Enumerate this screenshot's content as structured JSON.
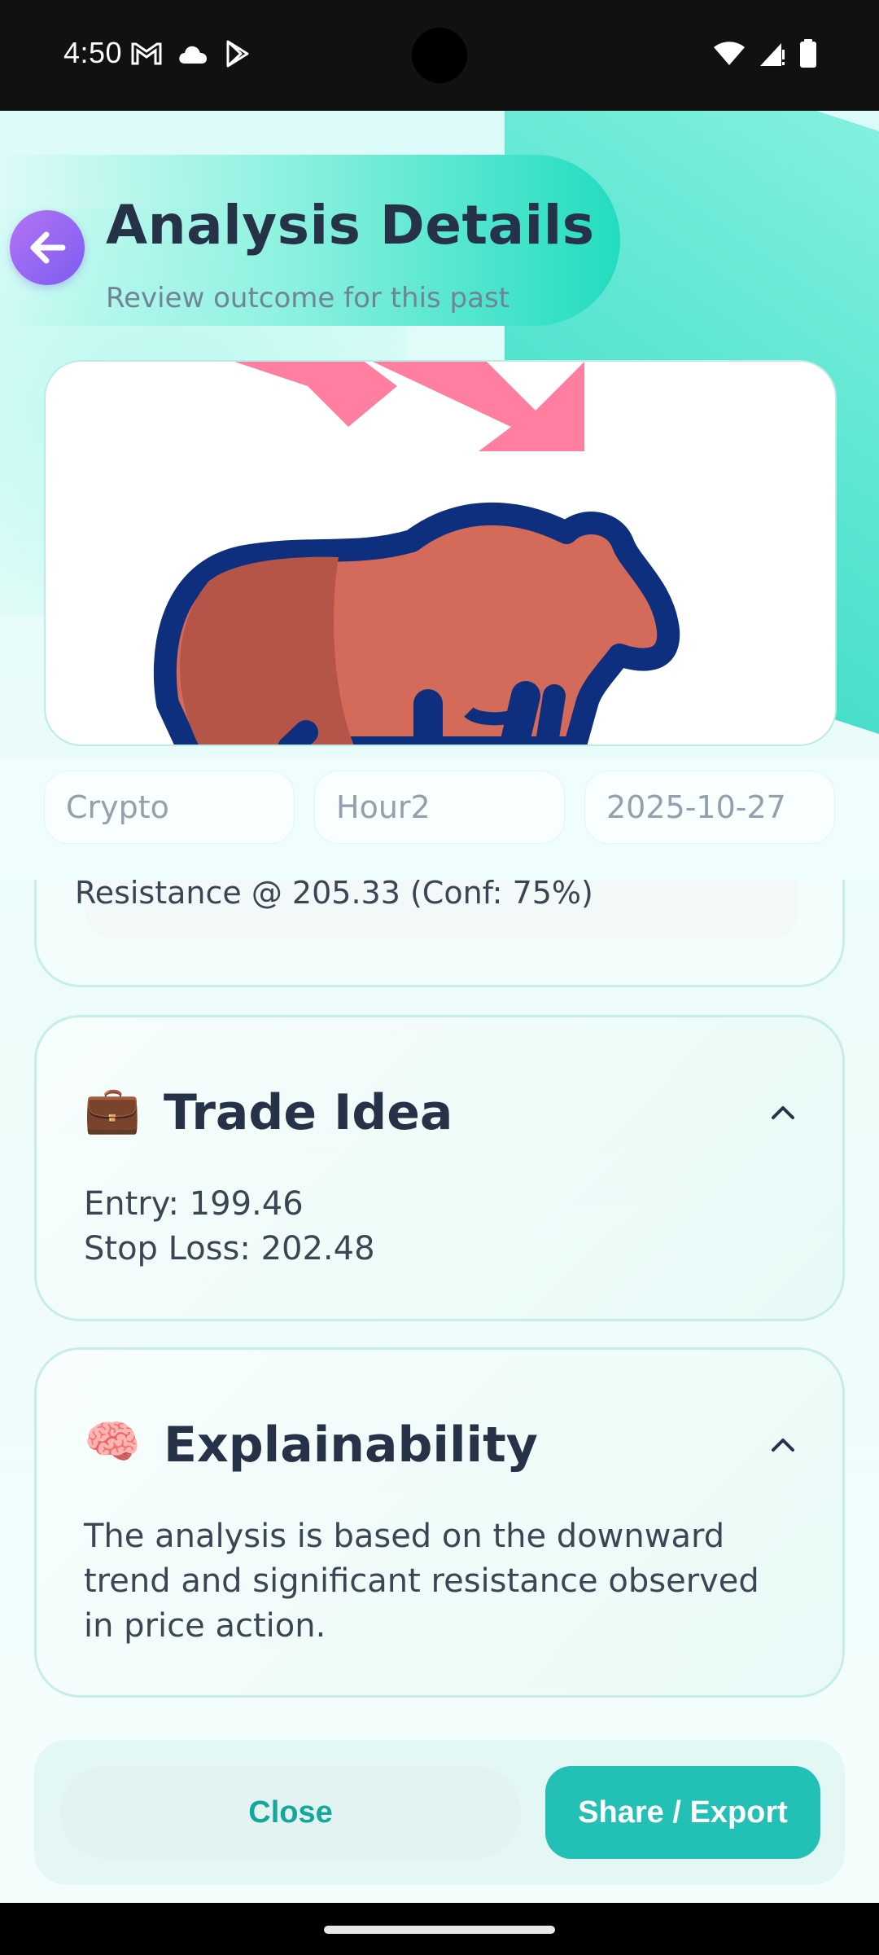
{
  "status_bar": {
    "time": "4:50",
    "left_icons": [
      "gmail-icon",
      "cloud-icon",
      "play-store-icon"
    ],
    "right_icons": [
      "wifi-icon",
      "signal-icon",
      "battery-icon"
    ]
  },
  "header": {
    "title": "Analysis Details",
    "subtitle": "Review outcome for this past",
    "back_icon": "arrow-left-icon"
  },
  "image": {
    "subject": "bear-market-illustration",
    "colors": {
      "bear": "#d46a5a",
      "outline": "#0e2f7e",
      "arrows": "#ff7fa1"
    }
  },
  "chips": [
    {
      "label": "Crypto"
    },
    {
      "label": "Hour2"
    },
    {
      "label": "2025-10-27"
    }
  ],
  "resistance": {
    "text": "Resistance @ 205.33  (Conf: 75%)"
  },
  "trade_idea": {
    "emoji": "💼",
    "title": "Trade Idea",
    "entry": "Entry: 199.46",
    "stop_loss": "Stop Loss: 202.48"
  },
  "explainability": {
    "emoji": "🧠",
    "title": "Explainability",
    "text": "The analysis is based on the downward trend and significant resistance observed in price action."
  },
  "actions": {
    "close_label": "Close",
    "share_label": "Share / Export"
  },
  "colors": {
    "accent": "#22c0b5",
    "title_text": "#263247",
    "back_button": "#8f63f2"
  }
}
